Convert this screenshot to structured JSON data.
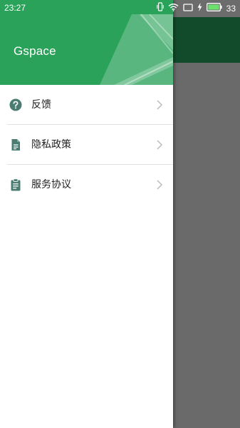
{
  "status_bar": {
    "time": "23:27",
    "battery_level": "33",
    "icons": [
      "vibrate-icon",
      "wifi-icon",
      "screen-cast-icon",
      "charging-icon",
      "battery-icon"
    ]
  },
  "drawer": {
    "app_title": "Gspace",
    "header_color": "#2aa25a",
    "menu": [
      {
        "label": "反馈",
        "icon": "help-circle-icon"
      },
      {
        "label": "隐私政策",
        "icon": "document-icon"
      },
      {
        "label": "服务协议",
        "icon": "clipboard-icon"
      }
    ]
  },
  "colors": {
    "accent": "#2aa25a",
    "icon": "#4a7c72",
    "background_app_top": "#124b2b",
    "scrim": "#6c6c6c"
  }
}
